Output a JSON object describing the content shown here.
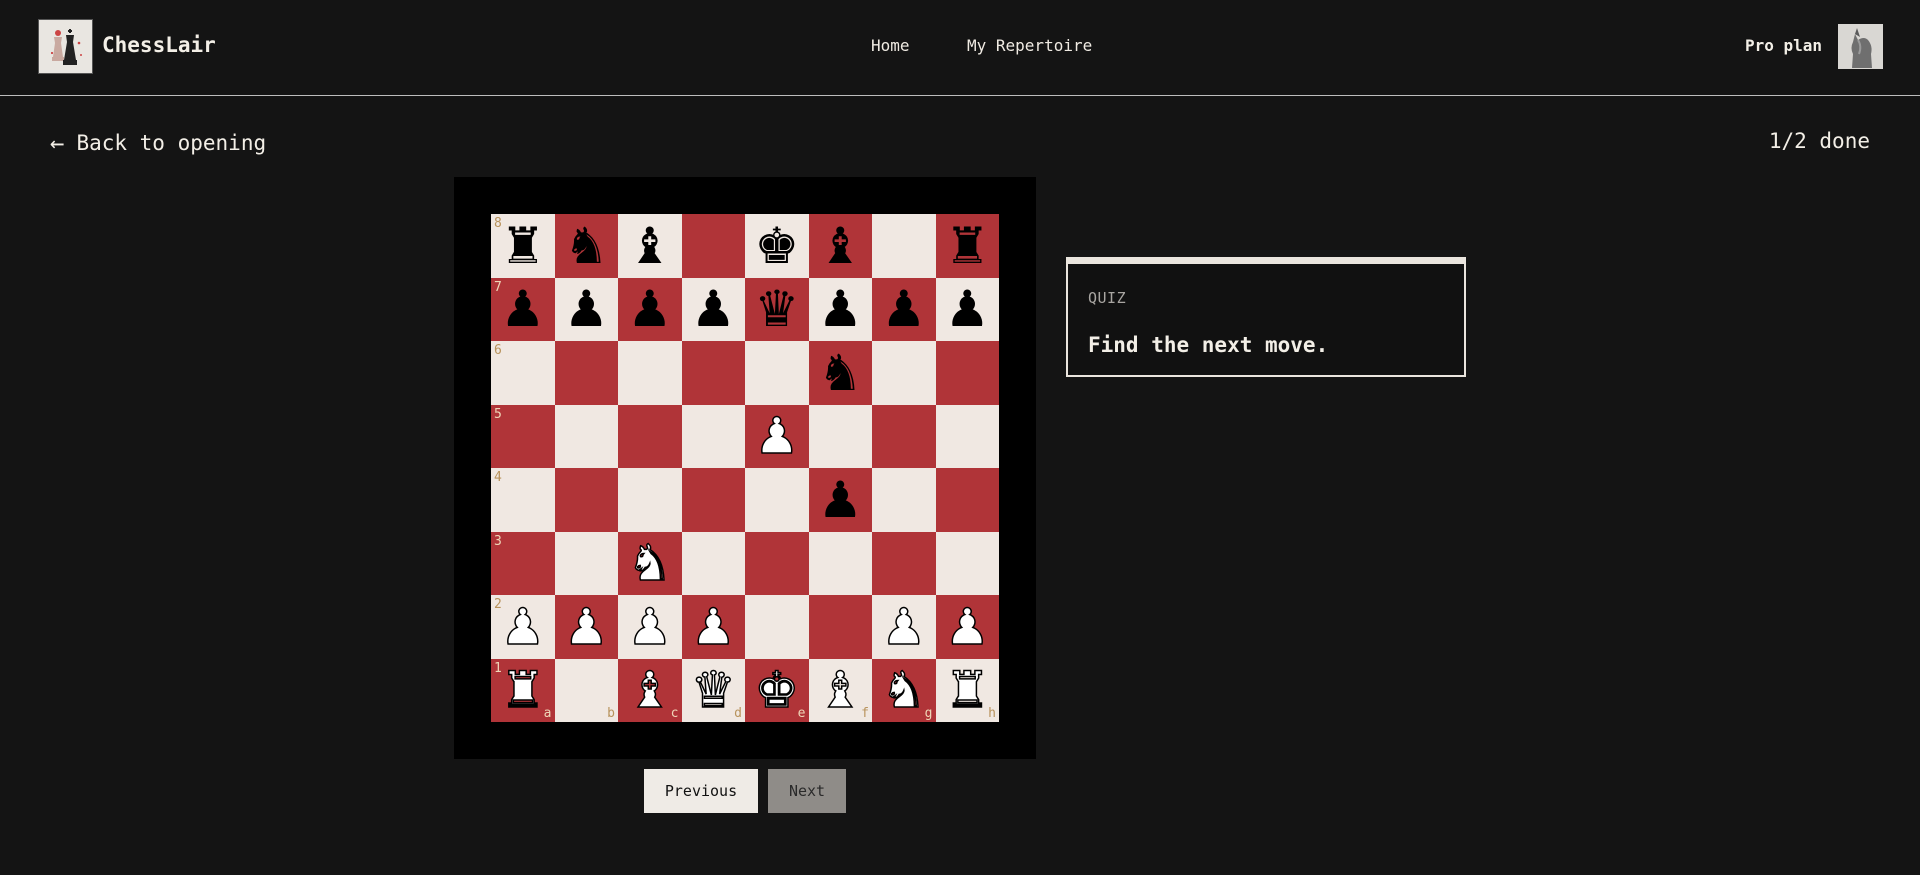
{
  "header": {
    "brand": "ChessLair",
    "nav": [
      {
        "label": "Home"
      },
      {
        "label": "My Repertoire"
      }
    ],
    "plan": "Pro plan",
    "logo_icon": "chess-king-queen-logo-icon",
    "avatar_icon": "knight-avatar-icon"
  },
  "subheader": {
    "back_label": "Back to opening",
    "back_icon": "←",
    "progress": "1/2 done"
  },
  "board": {
    "orientation": "white",
    "light_color": "#f0e8e2",
    "dark_color": "#b03438",
    "ranks": [
      "8",
      "7",
      "6",
      "5",
      "4",
      "3",
      "2",
      "1"
    ],
    "files": [
      "a",
      "b",
      "c",
      "d",
      "e",
      "f",
      "g",
      "h"
    ],
    "position": [
      [
        "r",
        "n",
        "b",
        "",
        "k",
        "b",
        "",
        "r"
      ],
      [
        "p",
        "p",
        "p",
        "p",
        "q",
        "p",
        "p",
        "p"
      ],
      [
        "",
        "",
        "",
        "",
        "",
        "n",
        "",
        ""
      ],
      [
        "",
        "",
        "",
        "",
        "P",
        "",
        "",
        ""
      ],
      [
        "",
        "",
        "",
        "",
        "",
        "p",
        "",
        ""
      ],
      [
        "",
        "",
        "N",
        "",
        "",
        "",
        "",
        ""
      ],
      [
        "P",
        "P",
        "P",
        "P",
        "",
        "",
        "P",
        "P"
      ],
      [
        "R",
        "",
        "B",
        "Q",
        "K",
        "B",
        "N",
        "R"
      ]
    ]
  },
  "controls": {
    "previous_label": "Previous",
    "next_label": "Next"
  },
  "quiz": {
    "label": "QUIZ",
    "prompt": "Find the next move."
  }
}
